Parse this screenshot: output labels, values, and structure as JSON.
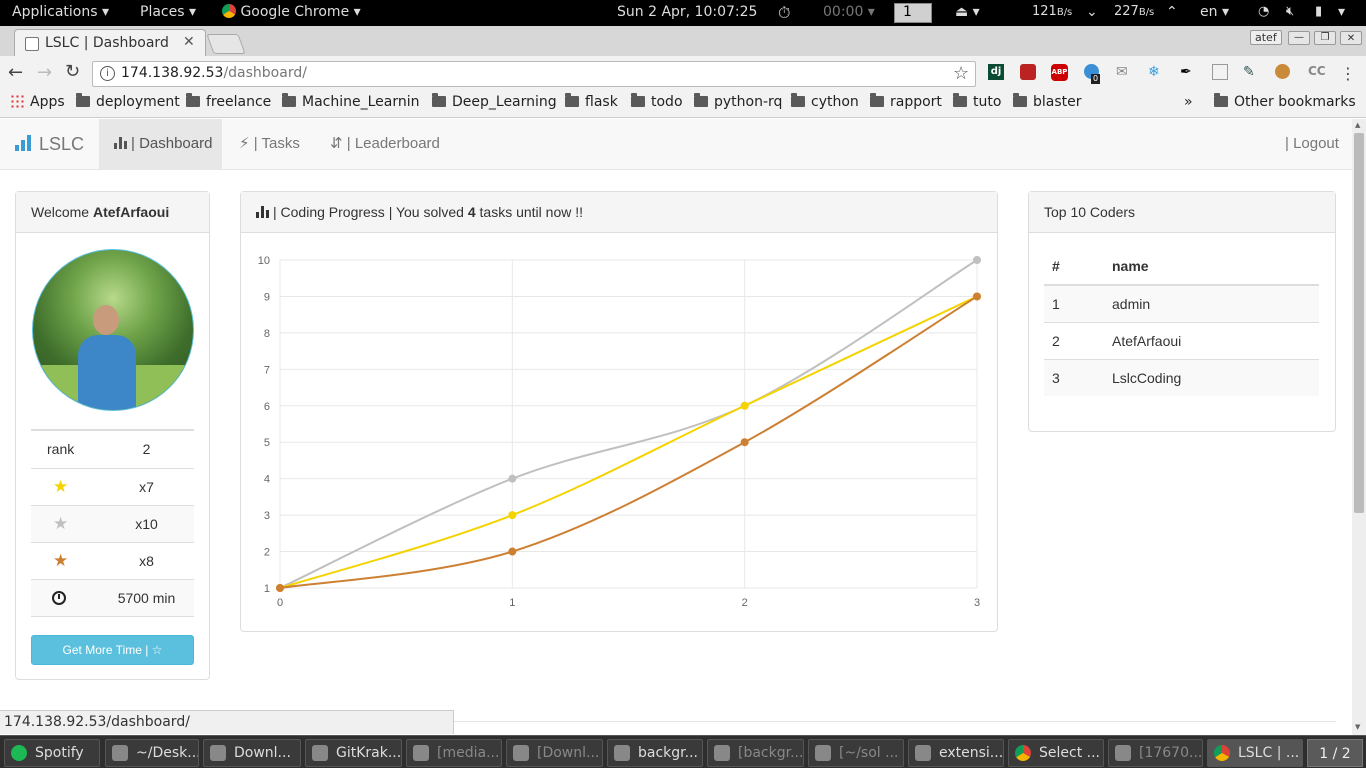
{
  "topbar": {
    "applications": "Applications",
    "places": "Places",
    "app": "Google Chrome",
    "clock": "Sun  2 Apr, 10:07:25",
    "timer": "00:00",
    "workspace": "1",
    "net_down": "121",
    "net_down_unit": "B/s",
    "net_up": "227",
    "net_up_unit": "B/s",
    "lang": "en"
  },
  "browser": {
    "tab_title": "LSLC | Dashboard",
    "profile": "atef",
    "url_host": "174.138.92.53",
    "url_path": "/dashboard/",
    "status_url": "174.138.92.53/dashboard/",
    "extension_badge": "0"
  },
  "bookmarks": {
    "apps": "Apps",
    "folders": [
      "deployment",
      "freelance",
      "Machine_Learning",
      "Deep_Learning",
      "flask",
      "todo",
      "python-rq",
      "cython",
      "rapport",
      "tuto",
      "blaster"
    ],
    "overflow": "»",
    "other": "Other bookmarks"
  },
  "nav": {
    "brand": "LSLC",
    "dashboard": "| Dashboard",
    "tasks": "| Tasks",
    "leaderboard": "| Leaderboard",
    "logout": "| Logout"
  },
  "profile": {
    "welcome": "Welcome ",
    "username": "AtefArfaoui",
    "rank_label": "rank",
    "rank_value": "2",
    "gold": "x7",
    "silver": "x10",
    "bronze": "x8",
    "time": "5700 min",
    "button": "Get More Time | ☆",
    "colors": {
      "gold": "#f5d300",
      "silver": "#c0c0c0",
      "bronze": "#cd7f32"
    }
  },
  "progress": {
    "title_pre": "| Coding Progress | You solved ",
    "count": "4",
    "title_post": " tasks until now !!"
  },
  "leaderboard": {
    "title": "Top 10 Coders",
    "headers": [
      "#",
      "name"
    ],
    "rows": [
      [
        "1",
        "admin"
      ],
      [
        "2",
        "AtefArfaoui"
      ],
      [
        "3",
        "LslcCoding"
      ]
    ]
  },
  "chart_data": {
    "type": "line",
    "x": [
      0,
      1,
      2,
      3
    ],
    "xlim": [
      0,
      3
    ],
    "ylim": [
      1,
      10
    ],
    "xticks": [
      "0",
      "1",
      "2",
      "3"
    ],
    "yticks": [
      "1",
      "2",
      "3",
      "4",
      "5",
      "6",
      "7",
      "8",
      "9",
      "10"
    ],
    "grid": true,
    "series": [
      {
        "color": "#c0c0c0",
        "values": [
          1,
          4,
          6,
          10
        ]
      },
      {
        "color": "#f5d300",
        "values": [
          1,
          3,
          6,
          9
        ]
      },
      {
        "color": "#cd7f32",
        "values": [
          1,
          2,
          5,
          9
        ]
      }
    ]
  },
  "taskbar": [
    {
      "label": "Spotify",
      "dim": false
    },
    {
      "label": "~/Desk...",
      "dim": false
    },
    {
      "label": "Downl...",
      "dim": false
    },
    {
      "label": "GitKrak...",
      "dim": false
    },
    {
      "label": "[media...",
      "dim": true
    },
    {
      "label": "[Downl...",
      "dim": true
    },
    {
      "label": "backgr...",
      "dim": false
    },
    {
      "label": "[backgr...",
      "dim": true
    },
    {
      "label": "[~/sol ...",
      "dim": true
    },
    {
      "label": "extensi...",
      "dim": false
    },
    {
      "label": "Select ...",
      "dim": false
    },
    {
      "label": "[17670...",
      "dim": true
    },
    {
      "label": "LSLC | ...",
      "dim": false
    }
  ],
  "pager": "1 / 2"
}
